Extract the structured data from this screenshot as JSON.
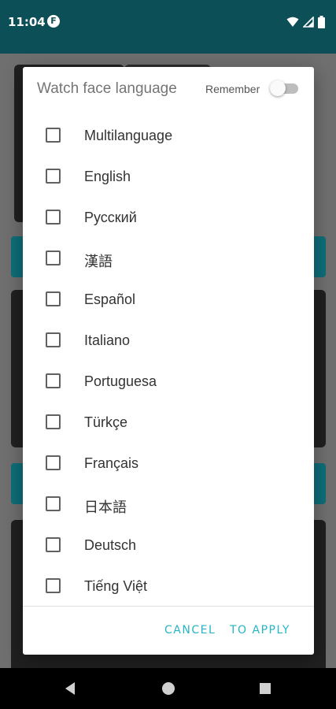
{
  "status_bar": {
    "time": "11:04",
    "notification_badge": "F",
    "icons": [
      "wifi-icon",
      "signal-icon",
      "battery-icon"
    ]
  },
  "dialog": {
    "title": "Watch face language",
    "remember_label": "Remember",
    "remember_on": false,
    "languages": [
      {
        "label": "Multilanguage",
        "checked": false
      },
      {
        "label": "English",
        "checked": false
      },
      {
        "label": "Русский",
        "checked": false
      },
      {
        "label": "漢語",
        "checked": false
      },
      {
        "label": "Español",
        "checked": false
      },
      {
        "label": "Italiano",
        "checked": false
      },
      {
        "label": "Portuguesa",
        "checked": false
      },
      {
        "label": "Türkçe",
        "checked": false
      },
      {
        "label": "Français",
        "checked": false
      },
      {
        "label": "日本語",
        "checked": false
      },
      {
        "label": "Deutsch",
        "checked": false
      },
      {
        "label": "Tiếng Việt",
        "checked": false
      }
    ],
    "cancel_label": "CANCEL",
    "apply_label": "TO APPLY"
  },
  "colors": {
    "status_bar": "#0c4f57",
    "accent": "#26b4c6",
    "scrim": "#7b7b7b"
  }
}
